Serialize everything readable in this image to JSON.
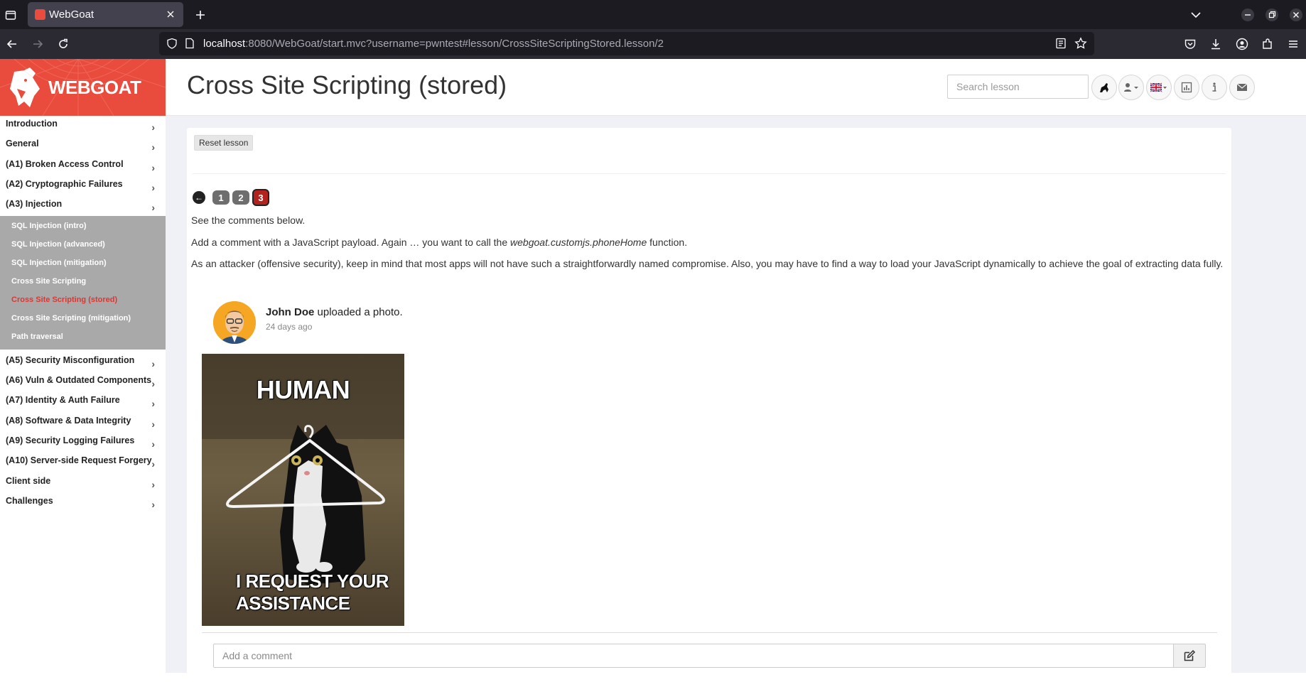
{
  "browser": {
    "tab_title": "WebGoat",
    "url_host": "localhost",
    "url_rest": ":8080/WebGoat/start.mvc?username=pwntest#lesson/CrossSiteScriptingStored.lesson/2"
  },
  "logo": {
    "text": "WEBGOAT"
  },
  "header": {
    "title": "Cross Site Scripting (stored)",
    "search_placeholder": "Search lesson"
  },
  "sidebar": {
    "categories_top": [
      {
        "label": "Introduction"
      },
      {
        "label": "General"
      },
      {
        "label": "(A1) Broken Access Control"
      },
      {
        "label": "(A2) Cryptographic Failures"
      },
      {
        "label": "(A3) Injection"
      }
    ],
    "injection_lessons": [
      {
        "label": "SQL Injection (intro)"
      },
      {
        "label": "SQL Injection (advanced)"
      },
      {
        "label": "SQL Injection (mitigation)"
      },
      {
        "label": "Cross Site Scripting"
      },
      {
        "label": "Cross Site Scripting (stored)"
      },
      {
        "label": "Cross Site Scripting (mitigation)"
      },
      {
        "label": "Path traversal"
      }
    ],
    "categories_bottom": [
      {
        "label": "(A5) Security Misconfiguration"
      },
      {
        "label": "(A6) Vuln & Outdated Components"
      },
      {
        "label": "(A7) Identity & Auth Failure"
      },
      {
        "label": "(A8) Software & Data Integrity"
      },
      {
        "label": "(A9) Security Logging Failures"
      },
      {
        "label": "(A10) Server-side Request Forgery"
      },
      {
        "label": "Client side"
      },
      {
        "label": "Challenges"
      }
    ]
  },
  "content": {
    "reset_label": "Reset lesson",
    "pages": [
      "1",
      "2",
      "3"
    ],
    "para1": "See the comments below.",
    "para2_before": "Add a comment with a JavaScript payload. Again … you want to call the ",
    "para2_em": "webgoat.customjs.phoneHome",
    "para2_after": " function.",
    "para3": "As an attacker (offensive security), keep in mind that most apps will not have such a straightforwardly named compromise. Also, you may have to find a way to load your JavaScript dynamically to achieve the goal of extracting data fully.",
    "post": {
      "author": "John Doe",
      "action": " uploaded a photo.",
      "time": "24 days ago",
      "meme_top": "HUMAN",
      "meme_bottom_1": "I REQUEST YOUR",
      "meme_bottom_2": "ASSISTANCE"
    },
    "comment_placeholder": "Add a comment"
  }
}
